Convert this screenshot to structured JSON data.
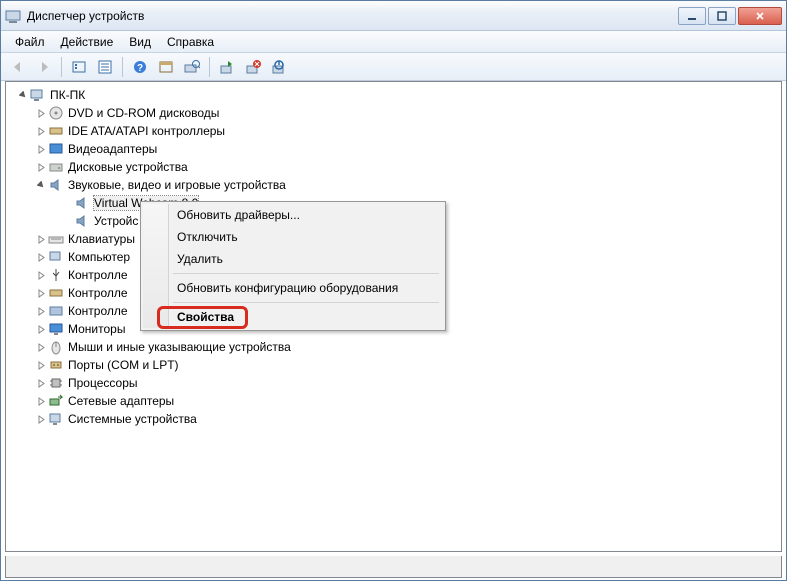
{
  "window": {
    "title": "Диспетчер устройств"
  },
  "menu": {
    "file": "Файл",
    "action": "Действие",
    "view": "Вид",
    "help": "Справка"
  },
  "tree": {
    "root": "ПК-ПК",
    "n0": "DVD и CD-ROM дисководы",
    "n1": "IDE ATA/ATAPI контроллеры",
    "n2": "Видеоадаптеры",
    "n3": "Дисковые устройства",
    "n4": "Звуковые, видео и игровые устройства",
    "n4_0": "Virtual Webcam 8.0",
    "n4_1": "Устройс",
    "n5": "Клавиатуры",
    "n6": "Компьютер",
    "n7": "Контролле",
    "n8": "Контролле",
    "n9": "Контролле",
    "n10": "Мониторы",
    "n11": "Мыши и иные указывающие устройства",
    "n12": "Порты (COM и LPT)",
    "n13": "Процессоры",
    "n14": "Сетевые адаптеры",
    "n15": "Системные устройства"
  },
  "ctx": {
    "update": "Обновить драйверы...",
    "disable": "Отключить",
    "delete": "Удалить",
    "rescan": "Обновить конфигурацию оборудования",
    "props": "Свойства"
  }
}
